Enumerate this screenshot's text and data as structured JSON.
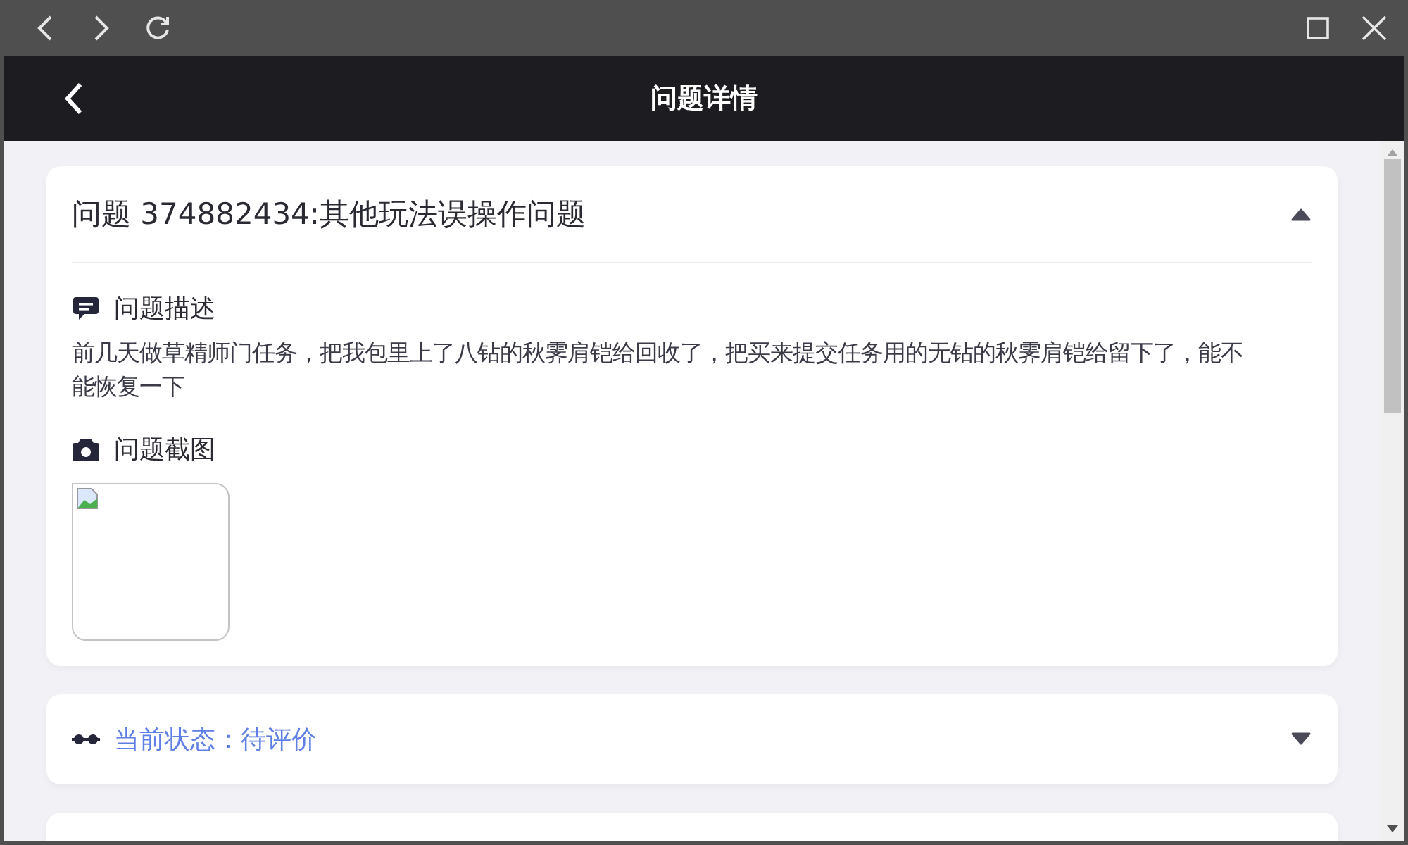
{
  "header": {
    "title": "问题详情"
  },
  "issue": {
    "title": "问题 374882434:其他玩法误操作问题",
    "expanded": true,
    "sections": [
      {
        "kind": "text",
        "heading": "问题描述",
        "body": "前几天做草精师门任务，把我包里上了八钻的秋霁肩铠给回收了，把买来提交任务用的无钻的秋霁肩铠给留下了，能不能恢复一下"
      },
      {
        "kind": "images",
        "heading": "问题截图"
      }
    ]
  },
  "status": {
    "label": "当前状态：待评价",
    "expanded": false
  }
}
